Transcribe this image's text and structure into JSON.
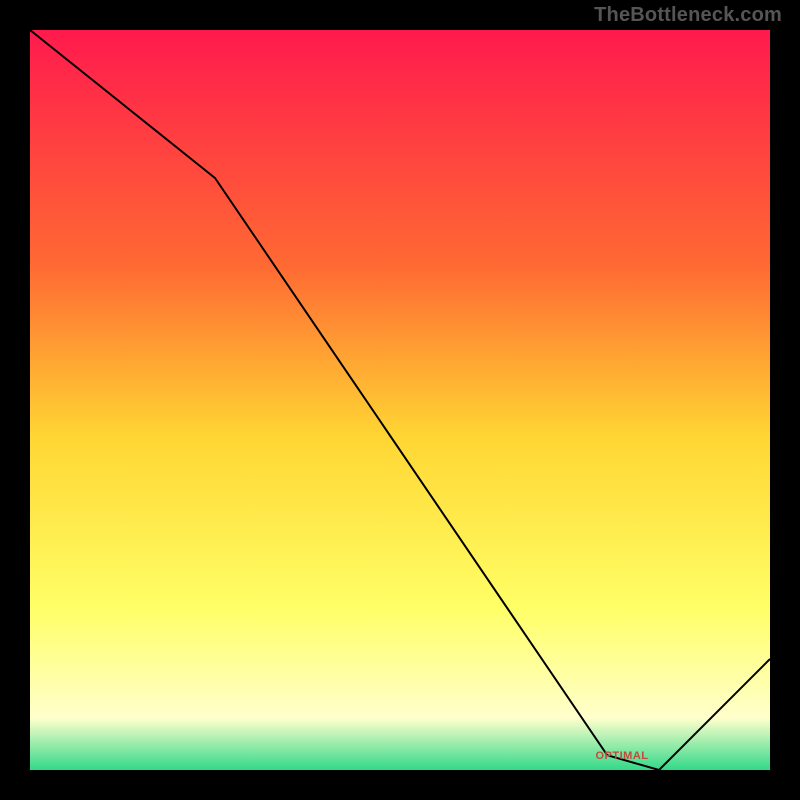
{
  "watermark": "TheBottleneck.com",
  "chart_data": {
    "type": "line",
    "title": "",
    "xlabel": "",
    "ylabel": "",
    "xlim": [
      0,
      100
    ],
    "ylim": [
      0,
      100
    ],
    "legend": false,
    "grid": false,
    "background_gradient": {
      "top": "#ff1a4d",
      "upper_mid": "#ff6a33",
      "mid": "#ffd633",
      "lower_mid": "#ffff66",
      "near_bottom": "#ffffcc",
      "bottom": "#33d98a"
    },
    "series": [
      {
        "name": "bottleneck-curve",
        "x": [
          0,
          25,
          78,
          85,
          100
        ],
        "values": [
          100,
          80,
          2,
          0,
          15
        ]
      }
    ],
    "annotations": [
      {
        "name": "optimal-label",
        "text": "OPTIMAL",
        "x": 80,
        "y": 1.5
      }
    ]
  }
}
